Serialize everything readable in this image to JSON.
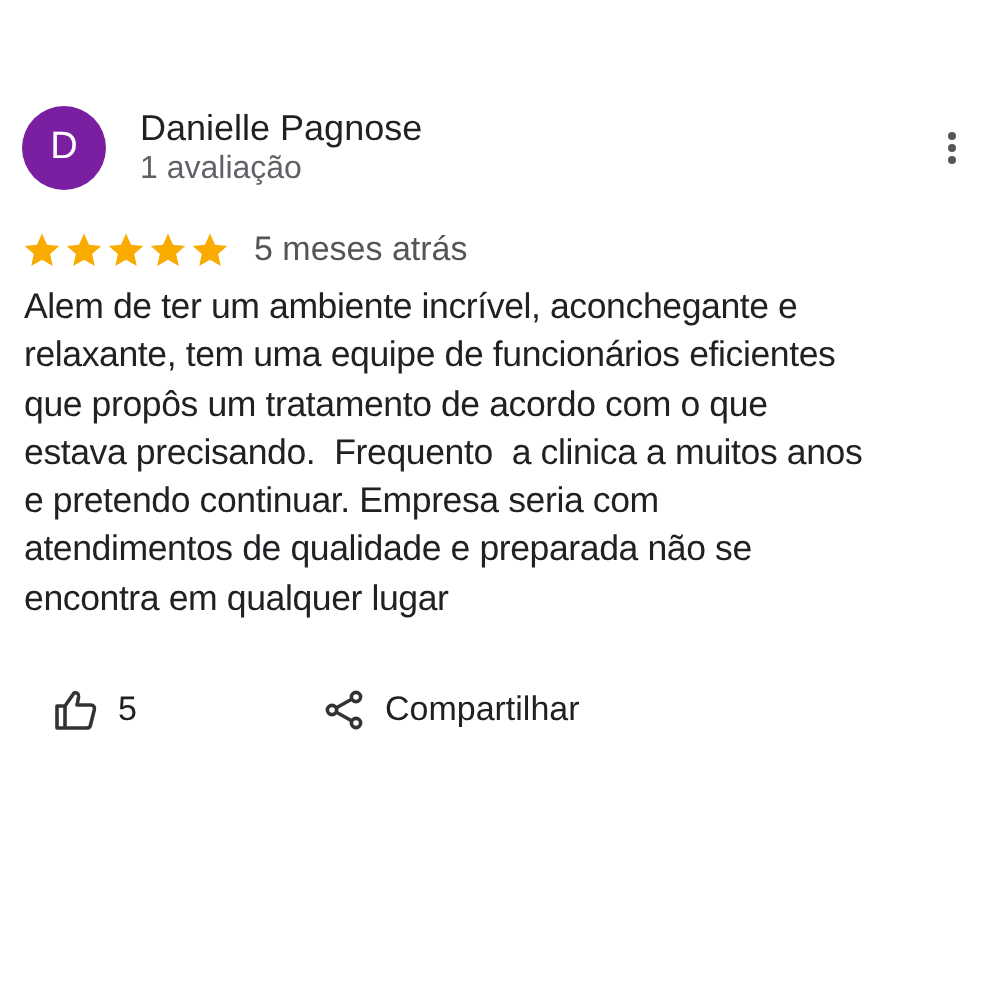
{
  "review": {
    "avatar_letter": "D",
    "author": "Danielle Pagnose",
    "author_meta": "1 avaliação",
    "stars": 5,
    "time": "5 meses atrás",
    "text": "Alem de ter um ambiente incrível, aconchegante e\nrelaxante, tem uma equipe de funcionários eficientes\nque propôs um tratamento de acordo com o que\nestava precisando.  Frequento  a clinica a muitos anos\ne pretendo continuar. Empresa seria com\natendimentos de qualidade e preparada não se\nencontra em qualquer lugar",
    "likes": "5",
    "share_label": "Compartilhar"
  }
}
